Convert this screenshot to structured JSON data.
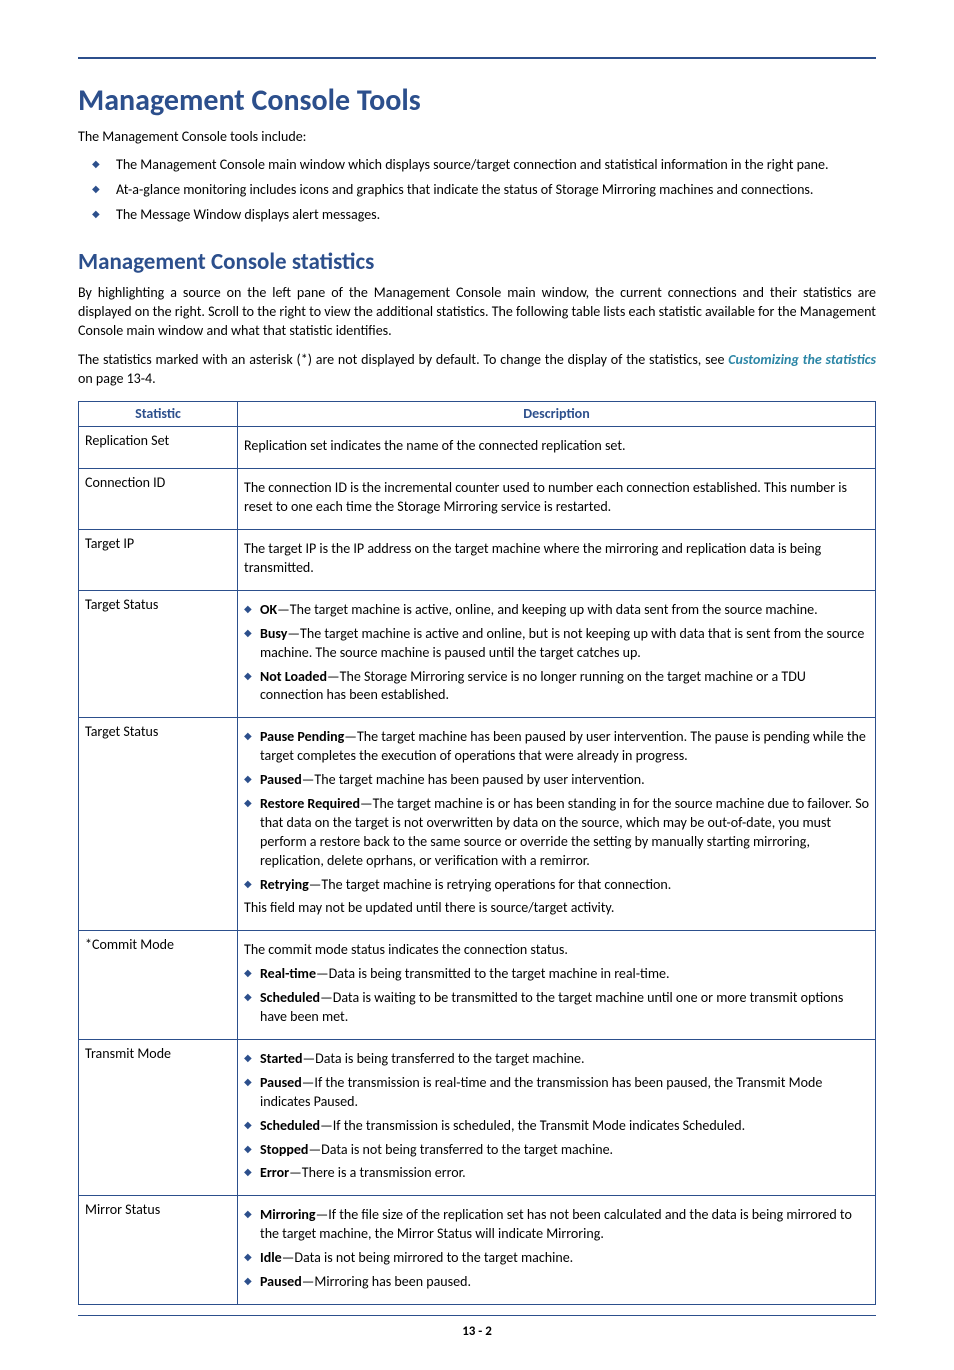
{
  "headings": {
    "h1": "Management Console Tools",
    "h2": "Management Console statistics"
  },
  "intro": {
    "p1": "The Management Console tools include:",
    "bullets": [
      "The Management Console main window which displays source/target connection and statistical information in the right pane.",
      "At-a-glance monitoring includes icons and graphics that indicate the status of Storage Mirroring machines and connections.",
      "The Message Window displays alert messages."
    ]
  },
  "stats_intro": {
    "p1": "By highlighting a source on the left pane of the Management Console main window, the current connections and their statistics are displayed on the right. Scroll to the right to view the additional statistics. The following table lists each statistic available for the Management Console main window and what that statistic identifies.",
    "p2_pre": "The statistics marked with an asterisk (*) are not displayed by default. To change the display of the statistics, see ",
    "p2_link": "Customizing the statistics",
    "p2_post": " on page 13-4."
  },
  "table": {
    "headers": {
      "c1": "Statistic",
      "c2": "Description"
    },
    "rows": [
      {
        "name": "Replication Set",
        "content": [
          {
            "type": "plain",
            "text": "Replication set indicates the name of the connected replication set."
          }
        ]
      },
      {
        "name": "Connection ID",
        "content": [
          {
            "type": "plain",
            "text": "The connection ID is the incremental counter used to number each connection established. This number is reset to one each time the Storage Mirroring service is restarted."
          }
        ]
      },
      {
        "name": "Target IP",
        "content": [
          {
            "type": "plain",
            "text": "The target IP is the IP address on the target machine where the mirroring and replication data is being transmitted."
          }
        ]
      },
      {
        "name": "Target Status",
        "content": [
          {
            "type": "term",
            "term": "OK",
            "text": "—The target machine is active, online, and keeping up with data sent from the source machine."
          },
          {
            "type": "term",
            "term": "Busy",
            "text": "—The target machine is active and online, but is not keeping up with data that is sent from the source machine.  The source machine is paused until the target catches up."
          },
          {
            "type": "term",
            "term": "Not Loaded",
            "text": "—The Storage Mirroring service is no longer running on the target machine or a TDU connection has been established."
          }
        ]
      },
      {
        "name": "Target Status",
        "content": [
          {
            "type": "term",
            "term": "Pause Pending",
            "text": "—The target machine has been paused by user intervention. The pause is pending while the target completes the execution of operations that were already in progress."
          },
          {
            "type": "term",
            "term": "Paused",
            "text": "—The target machine has been paused by user intervention."
          },
          {
            "type": "term",
            "term": "Restore Required",
            "text": "—The target machine is or has been standing in for the source machine due to failover. So that data on the target is not overwritten by data on the source, which may be out-of-date, you must perform a restore back to the same source or override the setting by manually starting mirroring, replication, delete oprhans, or verification with a remirror."
          },
          {
            "type": "term",
            "term": "Retrying",
            "text": "—The target machine is retrying operations for that connection."
          },
          {
            "type": "plain",
            "text": "This field may not be updated until there is source/target activity."
          }
        ]
      },
      {
        "name": "*Commit Mode",
        "content": [
          {
            "type": "plain",
            "text": "The commit mode status indicates the connection status."
          },
          {
            "type": "term",
            "term": "Real-time",
            "text": "—Data is being transmitted to the target machine in real-time."
          },
          {
            "type": "term",
            "term": "Scheduled",
            "text": "—Data is waiting to be transmitted to the target machine until one or more transmit options have been met."
          }
        ]
      },
      {
        "name": "Transmit Mode",
        "content": [
          {
            "type": "term",
            "term": "Started",
            "text": "—Data is being transferred to the target machine."
          },
          {
            "type": "term",
            "term": "Paused",
            "text": "—If the transmission is real-time and the transmission has been paused, the Transmit Mode indicates Paused."
          },
          {
            "type": "term",
            "term": "Scheduled",
            "text": "—If the transmission is scheduled, the Transmit Mode indicates Scheduled."
          },
          {
            "type": "term",
            "term": "Stopped",
            "text": "—Data is not being transferred to the target machine."
          },
          {
            "type": "term",
            "term": "Error",
            "text": "—There is a transmission error."
          }
        ]
      },
      {
        "name": "Mirror Status",
        "content": [
          {
            "type": "term",
            "term": "Mirroring",
            "text": "—If the file size of the replication set has not been calculated and the data is being mirrored to the target machine, the Mirror Status will indicate Mirroring."
          },
          {
            "type": "term",
            "term": "Idle",
            "text": "—Data is not being mirrored to the target machine."
          },
          {
            "type": "term",
            "term": "Paused",
            "text": "—Mirroring has been paused."
          }
        ]
      }
    ]
  },
  "page_number": "13 - 2"
}
